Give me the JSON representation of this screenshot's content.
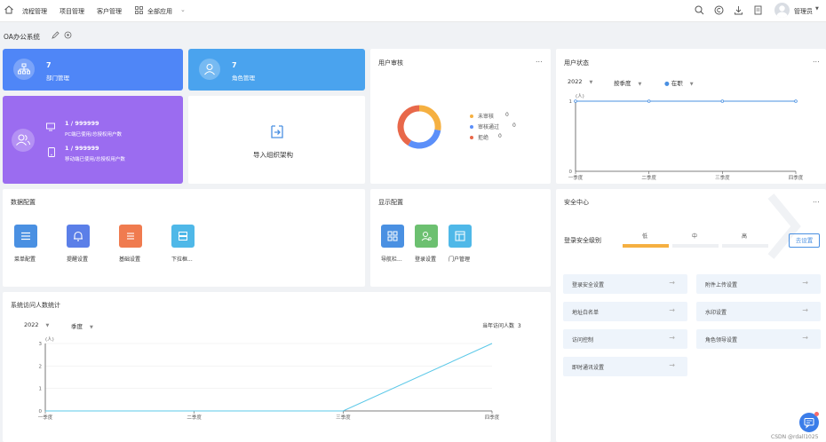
{
  "topbar": {
    "nav": [
      "流程管理",
      "项目管理",
      "客户管理",
      "全部应用"
    ],
    "user": "管理员"
  },
  "breadcrumb": {
    "title": "OA办公系统"
  },
  "dept_tile": {
    "count": "7",
    "label": "部门管理"
  },
  "role_tile": {
    "count": "7",
    "label": "角色管理"
  },
  "license_tile": {
    "pc_value": "1 / 999999",
    "pc_label": "PC端已使用/总授权用户数",
    "mobile_value": "1 / 999999",
    "mobile_label": "移动端已使用/总授权用户数"
  },
  "import_tile": {
    "label": "导入组织架构"
  },
  "audit_card": {
    "title": "用户审核",
    "more": "...",
    "legend": [
      {
        "label": "未审核",
        "value": "0",
        "color": "#f5b041"
      },
      {
        "label": "审核通过",
        "value": "0",
        "color": "#5b8ff9"
      },
      {
        "label": "拒绝",
        "value": "0",
        "color": "#e8684a"
      }
    ]
  },
  "status_card": {
    "title": "用户状态",
    "more": "...",
    "year": "2022",
    "period": "按季度",
    "status": "在职",
    "unit": "(人)",
    "chart_data": {
      "type": "line",
      "categories": [
        "一季度",
        "二季度",
        "三季度",
        "四季度"
      ],
      "values": [
        1,
        1,
        1,
        1
      ],
      "ylim": [
        0,
        1
      ],
      "yticks": [
        "1",
        "0"
      ]
    }
  },
  "data_config": {
    "title": "数据配置",
    "items": [
      {
        "label": "菜单配置",
        "color": "#4a90e2"
      },
      {
        "label": "提醒设置",
        "color": "#5b7fe8"
      },
      {
        "label": "基础设置",
        "color": "#f07b4f"
      },
      {
        "label": "下拉框...",
        "color": "#4fb8e8"
      }
    ]
  },
  "display_config": {
    "title": "显示配置",
    "items": [
      {
        "label": "导航栏...",
        "color": "#4a90e2"
      },
      {
        "label": "登录设置",
        "color": "#6cc070"
      },
      {
        "label": "门户管理",
        "color": "#4fb8e8"
      }
    ]
  },
  "security": {
    "title": "安全中心",
    "more": "...",
    "level_label": "登录安全级别",
    "levels": [
      "低",
      "中",
      "高"
    ],
    "set_button": "去设置",
    "items": [
      "登录安全设置",
      "附件上传设置",
      "地址白名单",
      "水印设置",
      "访问控制",
      "角色领导设置",
      "即时通讯设置"
    ]
  },
  "visits": {
    "title": "系统访问人数统计",
    "year": "2022",
    "period": "季度",
    "total_label": "当年访问人数",
    "total_value": "3",
    "unit": "(人)",
    "chart_data": {
      "type": "line",
      "categories": [
        "一季度",
        "二季度",
        "三季度",
        "四季度"
      ],
      "values": [
        0,
        0,
        0,
        3
      ],
      "ylim": [
        0,
        3
      ],
      "yticks": [
        "3",
        "2",
        "1",
        "0"
      ]
    }
  },
  "watermark": "CSDN @rdall1025"
}
